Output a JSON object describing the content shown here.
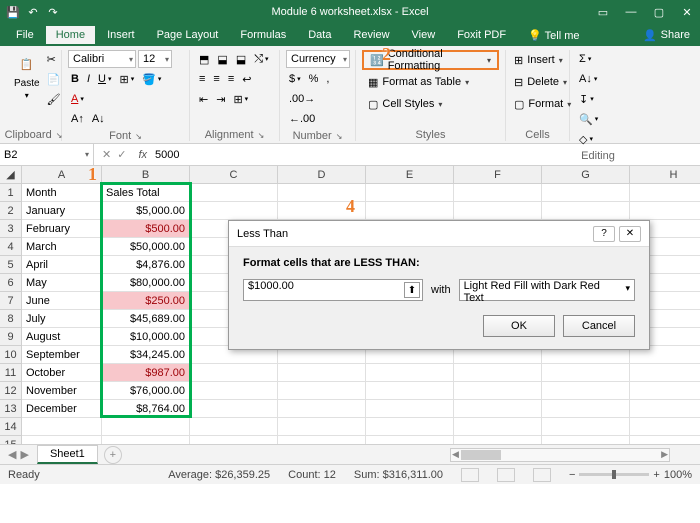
{
  "titlebar": {
    "title": "Module 6 worksheet.xlsx - Excel"
  },
  "tabs": {
    "file": "File",
    "home": "Home",
    "insert": "Insert",
    "page_layout": "Page Layout",
    "formulas": "Formulas",
    "data": "Data",
    "review": "Review",
    "view": "View",
    "foxit": "Foxit PDF",
    "tellme": "Tell me",
    "share": "Share"
  },
  "ribbon": {
    "clipboard": {
      "paste": "Paste",
      "label": "Clipboard"
    },
    "font": {
      "name": "Calibri",
      "size": "12",
      "label": "Font"
    },
    "alignment": {
      "label": "Alignment"
    },
    "number": {
      "format": "Currency",
      "label": "Number"
    },
    "styles": {
      "cond_fmt": "Conditional Formatting",
      "as_table": "Format as Table",
      "cell_styles": "Cell Styles",
      "label": "Styles"
    },
    "cells": {
      "insert": "Insert",
      "delete": "Delete",
      "format": "Format",
      "label": "Cells"
    },
    "editing": {
      "label": "Editing"
    }
  },
  "namebox": {
    "ref": "B2"
  },
  "formula": {
    "value": "5000"
  },
  "columns": [
    "A",
    "B",
    "C",
    "D",
    "E",
    "F",
    "G",
    "H"
  ],
  "data": {
    "header": {
      "a": "Month",
      "b": "Sales Total"
    },
    "rows": [
      {
        "a": "January",
        "b": "$5,000.00",
        "cf": false
      },
      {
        "a": "February",
        "b": "$500.00",
        "cf": true
      },
      {
        "a": "March",
        "b": "$50,000.00",
        "cf": false
      },
      {
        "a": "April",
        "b": "$4,876.00",
        "cf": false
      },
      {
        "a": "May",
        "b": "$80,000.00",
        "cf": false
      },
      {
        "a": "June",
        "b": "$250.00",
        "cf": true
      },
      {
        "a": "July",
        "b": "$45,689.00",
        "cf": false
      },
      {
        "a": "August",
        "b": "$10,000.00",
        "cf": false
      },
      {
        "a": "September",
        "b": "$34,245.00",
        "cf": false
      },
      {
        "a": "October",
        "b": "$987.00",
        "cf": true
      },
      {
        "a": "November",
        "b": "$76,000.00",
        "cf": false
      },
      {
        "a": "December",
        "b": "$8,764.00",
        "cf": false
      }
    ]
  },
  "dialog": {
    "title": "Less Than",
    "prompt": "Format cells that are LESS THAN:",
    "value": "$1000.00",
    "with": "with",
    "format_option": "Light Red Fill with Dark Red Text",
    "ok": "OK",
    "cancel": "Cancel"
  },
  "sheet": {
    "name": "Sheet1"
  },
  "status": {
    "mode": "Ready",
    "average_label": "Average:",
    "average": "$26,359.25",
    "count_label": "Count:",
    "count": "12",
    "sum_label": "Sum:",
    "sum": "$316,311.00",
    "zoom": "100%"
  },
  "annotations": {
    "n1": "1",
    "n2": "2",
    "n4": "4"
  }
}
